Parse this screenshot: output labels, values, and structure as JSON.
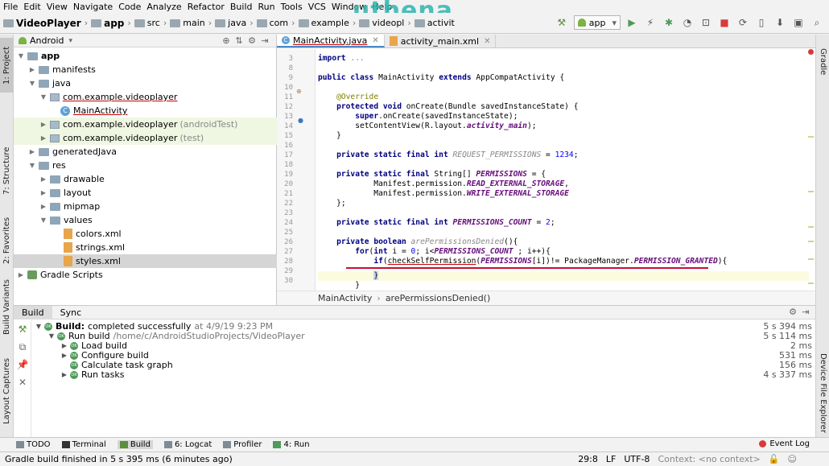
{
  "menu": [
    "File",
    "Edit",
    "View",
    "Navigate",
    "Code",
    "Analyze",
    "Refactor",
    "Build",
    "Run",
    "Tools",
    "VCS",
    "Window",
    "Help"
  ],
  "watermark": "uthena",
  "breadcrumbs": [
    "VideoPlayer",
    "app",
    "src",
    "main",
    "java",
    "com",
    "example",
    "videopl",
    "activit"
  ],
  "run_config": "app",
  "project_panel": {
    "view_label": "Android",
    "tree": [
      {
        "label": "app",
        "extra": ""
      },
      {
        "label": "manifests",
        "extra": ""
      },
      {
        "label": "java",
        "extra": ""
      },
      {
        "label": "com.example.videoplayer",
        "extra": ""
      },
      {
        "label": "MainActivity",
        "extra": ""
      },
      {
        "label": "com.example.videoplayer",
        "extra": "(androidTest)"
      },
      {
        "label": "com.example.videoplayer",
        "extra": "(test)"
      },
      {
        "label": "generatedJava",
        "extra": ""
      },
      {
        "label": "res",
        "extra": ""
      },
      {
        "label": "drawable",
        "extra": ""
      },
      {
        "label": "layout",
        "extra": ""
      },
      {
        "label": "mipmap",
        "extra": ""
      },
      {
        "label": "values",
        "extra": ""
      },
      {
        "label": "colors.xml",
        "extra": ""
      },
      {
        "label": "strings.xml",
        "extra": ""
      },
      {
        "label": "styles.xml",
        "extra": ""
      },
      {
        "label": "Gradle Scripts",
        "extra": ""
      }
    ]
  },
  "left_strip": [
    "1: Project",
    "7: Structure",
    "2: Favorites",
    "Build Variants",
    "Layout Captures"
  ],
  "right_strip": [
    "Gradle",
    "Device File Explorer"
  ],
  "editor": {
    "tabs": [
      "MainActivity.java",
      "activity_main.xml"
    ],
    "line_numbers": [
      "3",
      "8",
      "9",
      "10",
      "11",
      "12",
      "13",
      "14",
      "15",
      "16",
      "17",
      "18",
      "19",
      "20",
      "21",
      "22",
      "23",
      "24",
      "25",
      "26",
      "27",
      "28",
      "29",
      "30"
    ],
    "breadcrumb": [
      "MainActivity",
      "arePermissionsDenied()"
    ]
  },
  "build_panel": {
    "tabs": [
      "Build",
      "Sync"
    ],
    "rows": [
      {
        "label": "Build:",
        "rest": "completed successfully",
        "path": "at 4/9/19 9:23 PM",
        "time": "5 s 394 ms"
      },
      {
        "label": "Run build",
        "rest": "",
        "path": "/home/c/AndroidStudioProjects/VideoPlayer",
        "time": "5 s 114 ms"
      },
      {
        "label": "Load build",
        "rest": "",
        "path": "",
        "time": "2 ms"
      },
      {
        "label": "Configure build",
        "rest": "",
        "path": "",
        "time": "531 ms"
      },
      {
        "label": "Calculate task graph",
        "rest": "",
        "path": "",
        "time": "156 ms"
      },
      {
        "label": "Run tasks",
        "rest": "",
        "path": "",
        "time": "4 s 337 ms"
      }
    ]
  },
  "bottom_tabs": [
    "TODO",
    "Terminal",
    "Build",
    "6: Logcat",
    "Profiler",
    "4: Run"
  ],
  "event_log": "Event Log",
  "status": {
    "message": "Gradle build finished in 5 s 395 ms (6 minutes ago)",
    "position": "29:8",
    "line_sep": "LF",
    "encoding": "UTF-8",
    "context": "Context: <no context>"
  }
}
